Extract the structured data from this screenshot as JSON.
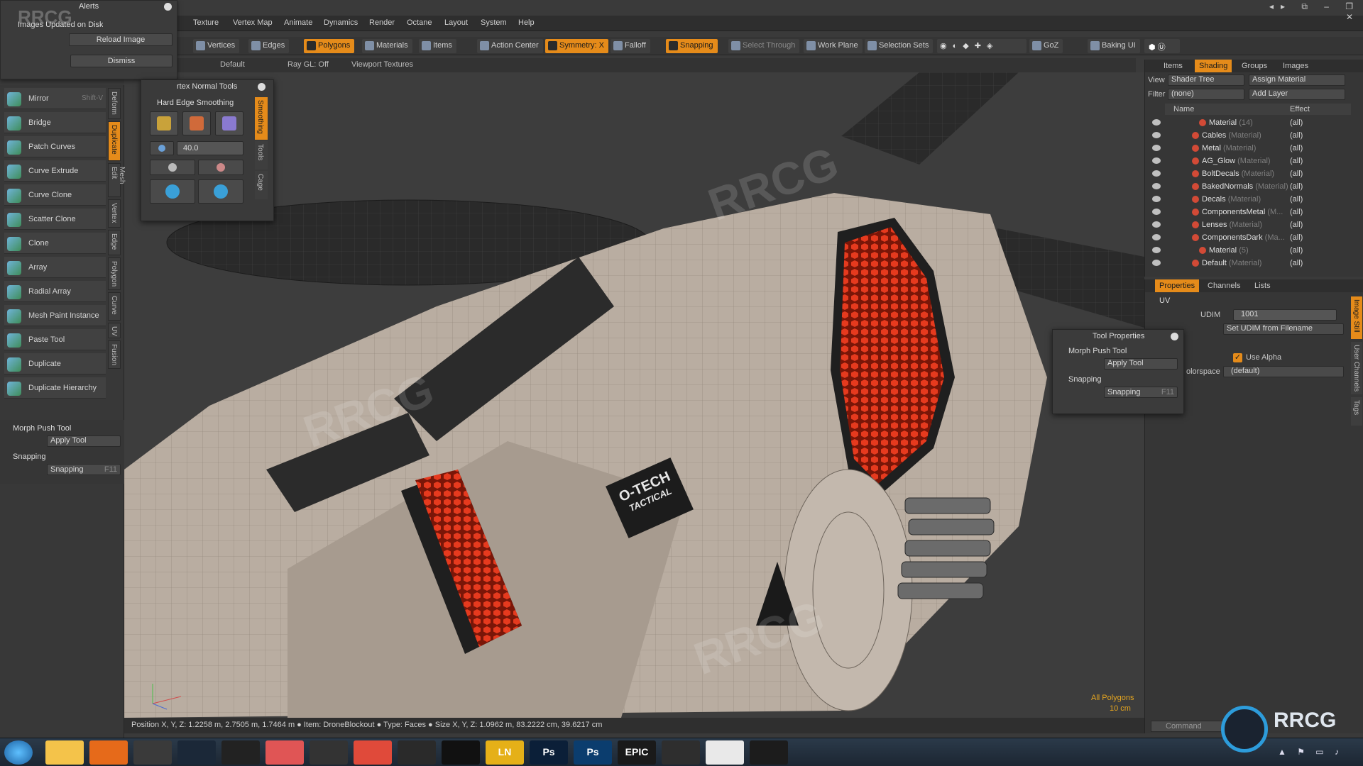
{
  "alerts": {
    "title": "Alerts",
    "message": "Images Updated on Disk",
    "reload_label": "Reload Image",
    "dismiss_label": "Dismiss"
  },
  "menu": [
    "Texture",
    "Vertex Map",
    "Animate",
    "Dynamics",
    "Render",
    "Octane",
    "Layout",
    "System",
    "Help"
  ],
  "toolbar": {
    "vertices": "Vertices",
    "edges": "Edges",
    "polygons": "Polygons",
    "materials": "Materials",
    "items": "Items",
    "action_center": "Action Center",
    "symmetry": "Symmetry: X",
    "falloff": "Falloff",
    "snapping": "Snapping",
    "select_through": "Select Through",
    "work_plane": "Work Plane",
    "selection_sets": "Selection Sets",
    "goz": "GoZ",
    "baking_ui": "Baking UI"
  },
  "viewport_header": {
    "layout": "Default",
    "raygl": "Ray GL: Off",
    "textures": "Viewport Textures"
  },
  "left_tools": [
    {
      "label": "Mirror",
      "shortcut": "Shift-V"
    },
    {
      "label": "Bridge",
      "shortcut": ""
    },
    {
      "label": "Patch Curves",
      "shortcut": ""
    },
    {
      "label": "Curve Extrude",
      "shortcut": ""
    },
    {
      "label": "Curve Clone",
      "shortcut": ""
    },
    {
      "label": "Scatter Clone",
      "shortcut": ""
    },
    {
      "label": "Clone",
      "shortcut": ""
    },
    {
      "label": "Array",
      "shortcut": ""
    },
    {
      "label": "Radial Array",
      "shortcut": ""
    },
    {
      "label": "Mesh Paint Instance",
      "shortcut": ""
    },
    {
      "label": "Paste Tool",
      "shortcut": ""
    },
    {
      "label": "Duplicate",
      "shortcut": ""
    },
    {
      "label": "Duplicate Hierarchy",
      "shortcut": ""
    }
  ],
  "left_vtabs": [
    "Deform",
    "Duplicate",
    "Mesh Edit",
    "Vertex",
    "Edge",
    "Polygon",
    "Curve",
    "UV",
    "Fusion"
  ],
  "left_bottom": {
    "tool_header": "Morph Push Tool",
    "apply": "Apply Tool",
    "snap_header": "Snapping",
    "snap_button": "Snapping",
    "snap_key": "F11"
  },
  "hard_edge": {
    "title": "rtex Normal Tools",
    "section": "Hard Edge Smoothing",
    "value": "40.0",
    "tabs": [
      "Smoothing",
      "Tools",
      "Cage"
    ]
  },
  "shading": {
    "tabs": [
      "Items",
      "Shading",
      "Groups",
      "Images"
    ],
    "active_tab": "Shading",
    "view_label": "View",
    "view_value": "Shader Tree",
    "assign": "Assign Material",
    "filter_label": "Filter",
    "filter_value": "(none)",
    "add_layer": "Add Layer",
    "col_name": "Name",
    "col_effect": "Effect",
    "rows": [
      {
        "name": "Material",
        "type": "(14)",
        "effect": "(all)",
        "indent": 2
      },
      {
        "name": "Cables",
        "type": "(Material)",
        "effect": "(all)",
        "indent": 1
      },
      {
        "name": "Metal",
        "type": "(Material)",
        "effect": "(all)",
        "indent": 1
      },
      {
        "name": "AG_Glow",
        "type": "(Material)",
        "effect": "(all)",
        "indent": 1
      },
      {
        "name": "BoltDecals",
        "type": "(Material)",
        "effect": "(all)",
        "indent": 1
      },
      {
        "name": "BakedNormals",
        "type": "(Material)",
        "effect": "(all)",
        "indent": 1
      },
      {
        "name": "Decals",
        "type": "(Material)",
        "effect": "(all)",
        "indent": 1
      },
      {
        "name": "ComponentsMetal",
        "type": "(M...",
        "effect": "(all)",
        "indent": 1
      },
      {
        "name": "Lenses",
        "type": "(Material)",
        "effect": "(all)",
        "indent": 1
      },
      {
        "name": "ComponentsDark",
        "type": "(Ma...",
        "effect": "(all)",
        "indent": 1
      },
      {
        "name": "Material",
        "type": "(5)",
        "effect": "(all)",
        "indent": 2
      },
      {
        "name": "Default",
        "type": "(Material)",
        "effect": "(all)",
        "indent": 1
      }
    ]
  },
  "properties": {
    "tabs": [
      "Properties",
      "Channels",
      "Lists"
    ],
    "active_tab": "Properties",
    "section": "UV",
    "udim_label": "UDIM",
    "udim_value": "1001",
    "set_udim": "Set UDIM from Filename",
    "use_alpha": "Use Alpha",
    "colorspace_label": "olorspace",
    "colorspace_value": "(default)",
    "side_tabs": [
      "Image Still",
      "User Channels",
      "Tags"
    ]
  },
  "tool_properties": {
    "title": "Tool Properties",
    "morph": "Morph Push Tool",
    "apply": "Apply Tool",
    "snapping_header": "Snapping",
    "snapping_button": "Snapping",
    "snapping_key": "F11"
  },
  "viewport": {
    "all_polygons": "All Polygons",
    "scale": "10 cm",
    "decal_main": "O-TECH",
    "decal_sub": "TACTICAL"
  },
  "status_bar": {
    "text": "Position X, Y, Z:  1.2258 m, 2.7505 m, 1.7464 m ● Item:  DroneBlockout ● Type:  Faces ● Size X, Y, Z:  1.0962 m, 83.2222 cm, 39.6217 cm",
    "command": "Command"
  },
  "watermark": "RRCG",
  "taskbar_apps": [
    "",
    "",
    "",
    "",
    "",
    "",
    "",
    "",
    "",
    "",
    "LN",
    "Ps",
    "Ps",
    "EPIC",
    "",
    "",
    ""
  ],
  "colors": {
    "accent": "#e58b1a",
    "hex_red": "#e63a1e",
    "drone_body": "#b9ada1"
  }
}
